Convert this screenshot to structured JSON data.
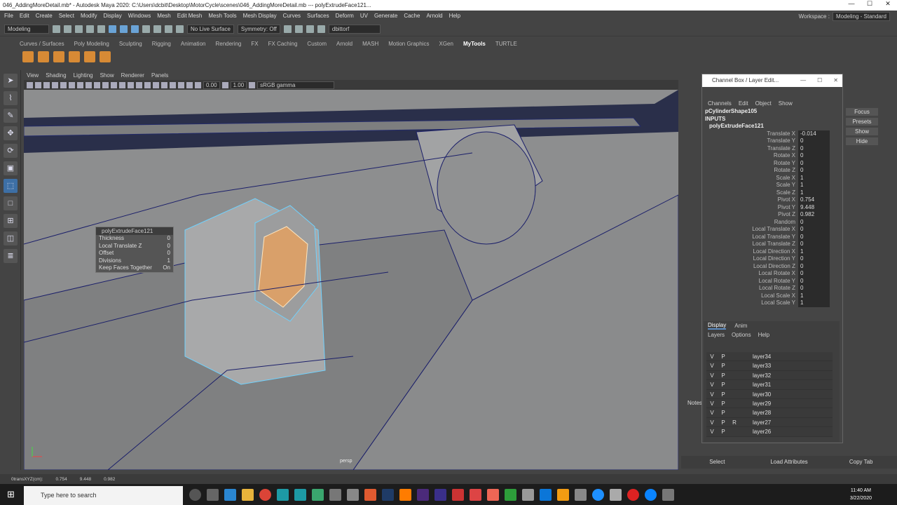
{
  "window": {
    "title": "046_AddingMoreDetail.mb* - Autodesk Maya 2020: C:\\Users\\dcbit\\Desktop\\MotorCycle\\scenes\\046_AddingMoreDetail.mb  ---  polyExtrudeFace121..."
  },
  "menubar": [
    "File",
    "Edit",
    "Create",
    "Select",
    "Modify",
    "Display",
    "Windows",
    "Mesh",
    "Edit Mesh",
    "Mesh Tools",
    "Mesh Display",
    "Curves",
    "Surfaces",
    "Deform",
    "UV",
    "Generate",
    "Cache",
    "Arnold",
    "Help"
  ],
  "workspace": {
    "label": "Workspace :",
    "value": "Modeling - Standard"
  },
  "statusline": {
    "mode": "Modeling",
    "live_surface": "No Live Surface",
    "symmetry": "Symmetry: Off",
    "user": "dbittorf"
  },
  "shelf_tabs": [
    "Curves / Surfaces",
    "Poly Modeling",
    "Sculpting",
    "Rigging",
    "Animation",
    "Rendering",
    "FX",
    "FX Caching",
    "Custom",
    "Arnold",
    "MASH",
    "Motion Graphics",
    "XGen",
    "MyTools",
    "TURTLE"
  ],
  "active_shelf": "MyTools",
  "viewport": {
    "menu": [
      "View",
      "Shading",
      "Lighting",
      "Show",
      "Renderer",
      "Panels"
    ],
    "field1": "0.00",
    "field2": "1.00",
    "color_space": "sRGB gamma",
    "camera": "persp"
  },
  "hud": {
    "title": "polyExtrudeFace121",
    "rows": [
      {
        "label": "Thickness",
        "value": "0"
      },
      {
        "label": "Local Translate Z",
        "value": "0"
      },
      {
        "label": "Offset",
        "value": "0"
      },
      {
        "label": "Divisions",
        "value": "1"
      },
      {
        "label": "Keep Faces Together",
        "value": "On"
      }
    ]
  },
  "channel_box": {
    "title": "Channel Box / Layer Edit...",
    "menu": [
      "Channels",
      "Edit",
      "Object",
      "Show"
    ],
    "shape": "pCylinderShape105",
    "inputs": "INPUTS",
    "node": "polyExtrudeFace121",
    "attrs": [
      {
        "name": "Translate X",
        "value": "-0.014"
      },
      {
        "name": "Translate Y",
        "value": "0"
      },
      {
        "name": "Translate Z",
        "value": "0"
      },
      {
        "name": "Rotate X",
        "value": "0"
      },
      {
        "name": "Rotate Y",
        "value": "0"
      },
      {
        "name": "Rotate Z",
        "value": "0"
      },
      {
        "name": "Scale X",
        "value": "1"
      },
      {
        "name": "Scale Y",
        "value": "1"
      },
      {
        "name": "Scale Z",
        "value": "1"
      },
      {
        "name": "Pivot X",
        "value": "0.754"
      },
      {
        "name": "Pivot Y",
        "value": "9.448"
      },
      {
        "name": "Pivot Z",
        "value": "0.982"
      },
      {
        "name": "Random",
        "value": "0"
      },
      {
        "name": "Local Translate X",
        "value": "0"
      },
      {
        "name": "Local Translate Y",
        "value": "0"
      },
      {
        "name": "Local Translate Z",
        "value": "0"
      },
      {
        "name": "Local Direction X",
        "value": "1"
      },
      {
        "name": "Local Direction Y",
        "value": "0"
      },
      {
        "name": "Local Direction Z",
        "value": "0"
      },
      {
        "name": "Local Rotate X",
        "value": "0"
      },
      {
        "name": "Local Rotate Y",
        "value": "0"
      },
      {
        "name": "Local Rotate Z",
        "value": "0"
      },
      {
        "name": "Local Scale X",
        "value": "1"
      },
      {
        "name": "Local Scale Y",
        "value": "1"
      }
    ]
  },
  "layer_editor": {
    "tabs": [
      "Display",
      "Anim"
    ],
    "menu": [
      "Layers",
      "Options",
      "Help"
    ],
    "layers": [
      {
        "v": "V",
        "p": "P",
        "r": "",
        "name": "layer34"
      },
      {
        "v": "V",
        "p": "P",
        "r": "",
        "name": "layer33"
      },
      {
        "v": "V",
        "p": "P",
        "r": "",
        "name": "layer32"
      },
      {
        "v": "V",
        "p": "P",
        "r": "",
        "name": "layer31"
      },
      {
        "v": "V",
        "p": "P",
        "r": "",
        "name": "layer30"
      },
      {
        "v": "V",
        "p": "P",
        "r": "",
        "name": "layer29"
      },
      {
        "v": "V",
        "p": "P",
        "r": "",
        "name": "layer28"
      },
      {
        "v": "V",
        "p": "P",
        "r": "R",
        "name": "layer27"
      },
      {
        "v": "V",
        "p": "P",
        "r": "",
        "name": "layer26"
      }
    ]
  },
  "right_buttons": [
    "Focus",
    "Presets",
    "Show",
    "Hide"
  ],
  "notes_label": "Notes",
  "attr_bottom": [
    "Select",
    "Load Attributes",
    "Copy Tab"
  ],
  "helpline": {
    "label": "0transXYZ(cm):",
    "x": "0.754",
    "y": "9.448",
    "z": "0.982"
  },
  "taskbar": {
    "search_placeholder": "Type here to search",
    "time": "11:40 AM",
    "date": "3/22/2020"
  }
}
